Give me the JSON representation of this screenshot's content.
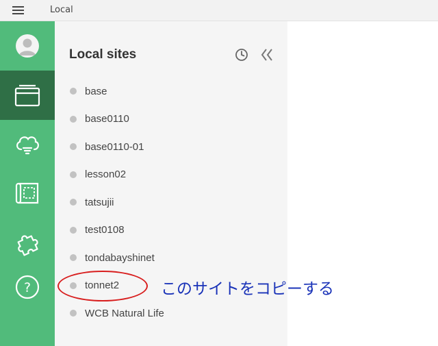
{
  "app": {
    "title": "Local"
  },
  "colors": {
    "rail": "#51bb7b",
    "rail_active": "#2f6f46",
    "panel": "#f5f5f5",
    "annotation_text": "#1a33b8",
    "annotation_ring": "#d81e1e"
  },
  "rail": {
    "items": [
      {
        "icon": "user-avatar-icon",
        "active": false
      },
      {
        "icon": "local-sites-icon",
        "active": true
      },
      {
        "icon": "cloud-connect-icon",
        "active": false
      },
      {
        "icon": "blueprints-icon",
        "active": false
      },
      {
        "icon": "addons-puzzle-icon",
        "active": false
      },
      {
        "icon": "help-icon",
        "active": false
      }
    ]
  },
  "panel": {
    "title": "Local sites",
    "icons": [
      "clock-icon",
      "collapse-icon"
    ],
    "sites": [
      {
        "name": "base"
      },
      {
        "name": "base0110"
      },
      {
        "name": "base0110-01"
      },
      {
        "name": "lesson02"
      },
      {
        "name": "tatsujii"
      },
      {
        "name": "test0108"
      },
      {
        "name": "tondabayshinet"
      },
      {
        "name": "tonnet2"
      },
      {
        "name": "WCB Natural Life"
      }
    ]
  },
  "annotation": {
    "text": "このサイトをコピーする"
  }
}
